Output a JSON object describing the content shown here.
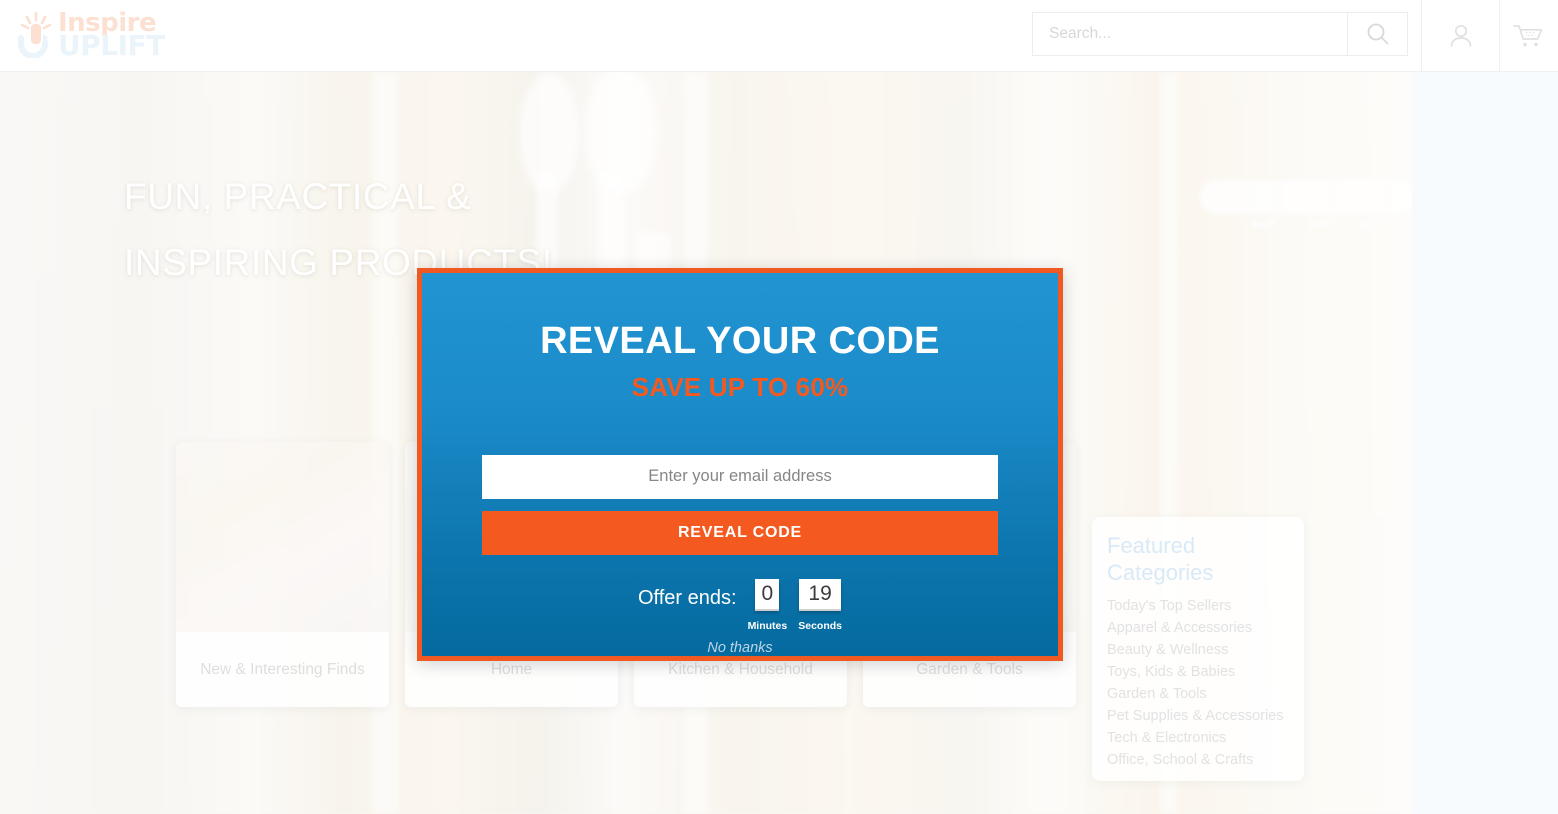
{
  "header": {
    "logo": {
      "line1": "Inspire",
      "line2": "UPLIFT",
      "mark_icon": "sparkle-u-logo-icon"
    },
    "search": {
      "placeholder": "Search...",
      "value": "",
      "icon": "search-icon"
    },
    "account_icon": "user-account-icon",
    "cart_icon": "shopping-cart-icon"
  },
  "hero": {
    "title_line1": "FUN, PRACTICAL &",
    "title_line2": "INSPIRING PRODUCTS!"
  },
  "category_cards": [
    {
      "label": "New & Interesting Finds"
    },
    {
      "label": "Home"
    },
    {
      "label": "Kitchen & Household"
    },
    {
      "label": "Garden & Tools"
    }
  ],
  "featured": {
    "title": "Featured Categories",
    "items": [
      "Today's Top Sellers",
      "Apparel & Accessories",
      "Beauty & Wellness",
      "Toys, Kids & Babies",
      "Garden & Tools",
      "Pet Supplies & Accessories",
      "Tech & Electronics",
      "Office, School & Crafts"
    ]
  },
  "modal": {
    "title": "REVEAL YOUR CODE",
    "subtitle": "SAVE UP TO 60%",
    "email_placeholder": "Enter your email address",
    "email_value": "",
    "submit_label": "REVEAL CODE",
    "timer_label": "Offer ends:",
    "minutes_value": "0",
    "minutes_label": "Minutes",
    "seconds_value": "19",
    "seconds_label": "Seconds",
    "dismiss_label": "No thanks",
    "border_color": "#f05a22",
    "accent_color": "#f4591f",
    "background_color": "#1b8bc9"
  }
}
